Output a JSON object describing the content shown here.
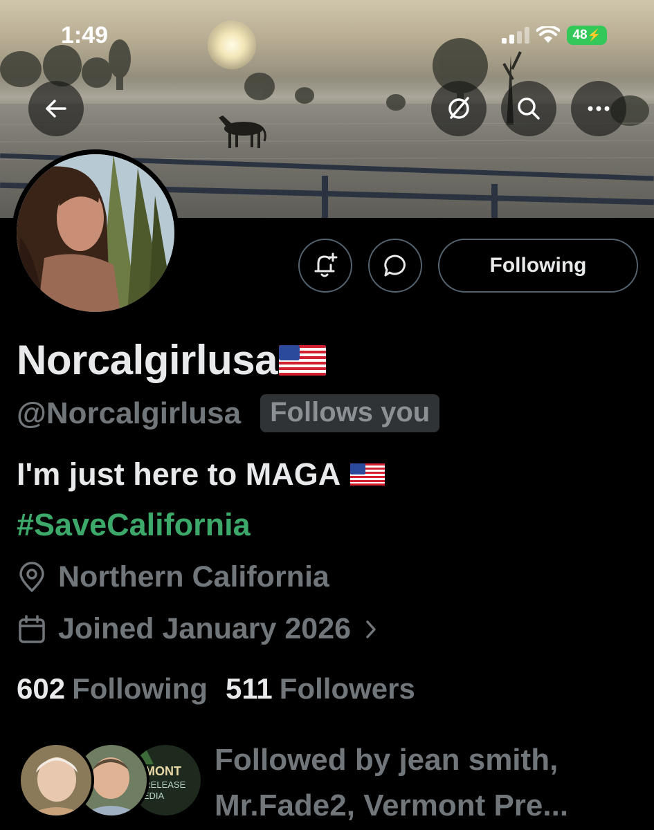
{
  "status_bar": {
    "time": "1:49",
    "battery": "48",
    "icons": [
      "cellular-signal-icon",
      "wifi-icon",
      "battery-charging-icon"
    ]
  },
  "header": {
    "buttons": [
      "back-arrow-icon",
      "grok-icon",
      "search-icon",
      "more-icon"
    ]
  },
  "profile": {
    "display_name": "Norcalgirlusa",
    "handle": "@Norcalgirlusa",
    "follows_you_badge": "Follows you",
    "bio_line1": "I'm just here to MAGA",
    "bio_hashtag": "#SaveCalifornia",
    "location": "Northern California",
    "joined": "Joined January 2026",
    "following_count": "602",
    "following_label": "Following",
    "followers_count": "511",
    "followers_label": "Followers",
    "followed_by_line1": "Followed by jean smith,",
    "followed_by_line2": "Mr.Fade2, Vermont Pre...",
    "mutual_avatar_text": [
      "RMONT",
      "S RELEASE",
      "MEDIA"
    ]
  },
  "actions": {
    "follow_button_label": "Following",
    "icons": [
      "bell-plus-icon",
      "message-icon"
    ]
  },
  "colors": {
    "background": "#000000",
    "primary_text": "#e7e9ea",
    "secondary_text": "#71767b",
    "hashtag": "#3ca96b",
    "border": "#536471",
    "badge_bg": "#2f3336",
    "battery": "#34c759"
  }
}
